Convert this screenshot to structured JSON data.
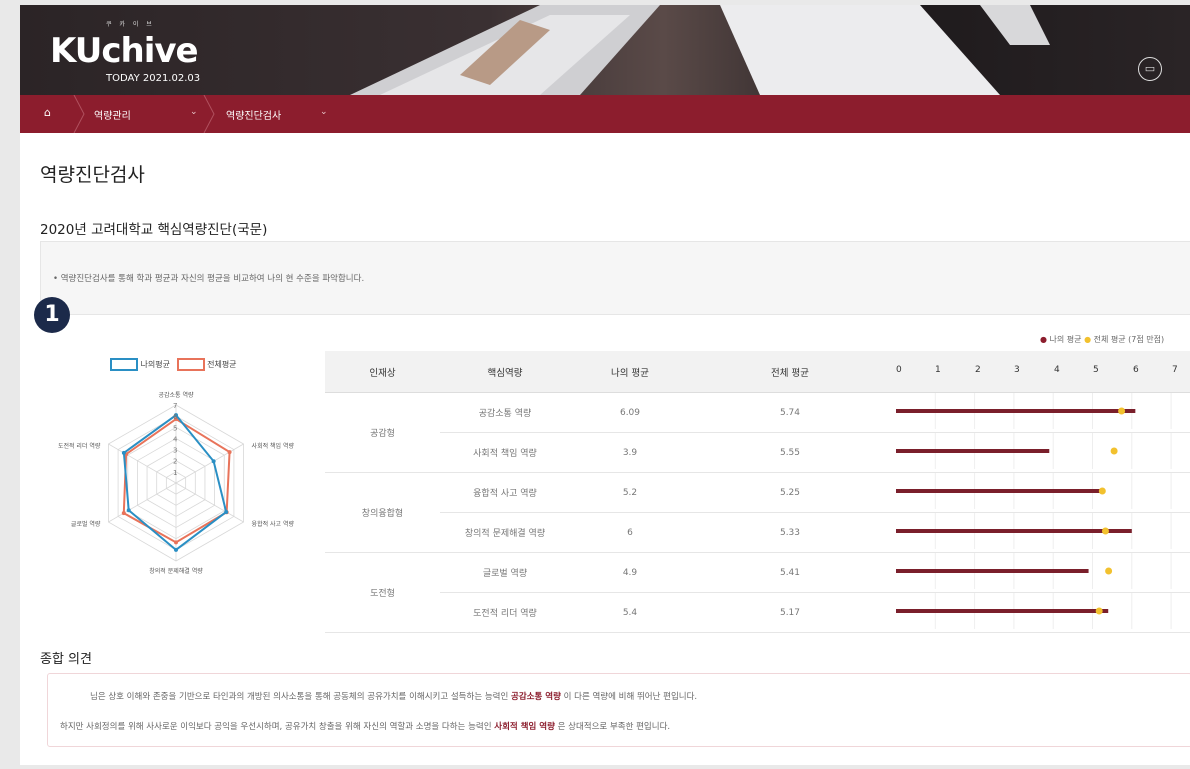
{
  "header": {
    "logo_small": "쿠 카 이 브",
    "logo_text": "KUchive",
    "today": "TODAY 2021.02.03",
    "icon": "book-icon"
  },
  "nav": {
    "home_icon": "home-icon",
    "items": [
      {
        "label": "역량관리"
      },
      {
        "label": "역량진단검사"
      }
    ]
  },
  "page_title": "역량진단검사",
  "subtitle": "2020년 고려대학교 핵심역량진단(국문)",
  "info": "• 역량진단검사를 통해 학과 평균과 자신의 평균을 비교하여 나의 현 수준을 파악합니다.",
  "badge": "1",
  "legend_top": {
    "mine": "나의 평균",
    "all": "전체 평균",
    "note": "(7점 만점)"
  },
  "colors": {
    "accent": "#8c1d2d",
    "mine_bar": "#7a1f2b",
    "all_dot": "#f2c12e",
    "radar_mine": "#2a8fc4",
    "radar_all": "#e8735a"
  },
  "radar": {
    "legend_mine": "나의평균",
    "legend_all": "전체평균",
    "axes": [
      "공감소통 역량",
      "사회적 책임 역량",
      "융합적 사고 역량",
      "창의적 문제해결 역량",
      "글로벌 역량",
      "도전적 리더 역량"
    ],
    "mine": [
      6.09,
      3.9,
      5.2,
      6,
      4.9,
      5.4
    ],
    "all": [
      5.74,
      5.55,
      5.25,
      5.33,
      5.41,
      5.17
    ],
    "ticks": [
      "1",
      "2",
      "3",
      "4",
      "5",
      "6",
      "7"
    ],
    "max": 7
  },
  "table": {
    "headers": [
      "인재상",
      "핵심역량",
      "나의 평균",
      "전체 평균"
    ],
    "scale": [
      "0",
      "1",
      "2",
      "3",
      "4",
      "5",
      "6",
      "7"
    ],
    "groups": [
      "공감형",
      "창의융합형",
      "도전형"
    ],
    "rows": [
      {
        "name": "공감소통 역량",
        "mine": "6.09",
        "all": "5.74"
      },
      {
        "name": "사회적 책임 역량",
        "mine": "3.9",
        "all": "5.55"
      },
      {
        "name": "융합적 사고 역량",
        "mine": "5.2",
        "all": "5.25"
      },
      {
        "name": "창의적 문제해결 역량",
        "mine": "6",
        "all": "5.33"
      },
      {
        "name": "글로벌 역량",
        "mine": "4.9",
        "all": "5.41"
      },
      {
        "name": "도전적 리더 역량",
        "mine": "5.4",
        "all": "5.17"
      }
    ]
  },
  "opinion": {
    "title": "종합 의견",
    "line1_pre": "님은 상호 이해와 존중을 기반으로 타인과의 개방된 의사소통을 통해 공동체의 공유가치를 이해시키고 설득하는 능력인 ",
    "line1_bold": "공감소통 역량",
    "line1_post": " 이 다른 역량에 비해 뛰어난 편입니다.",
    "line2_pre": "하지만 사회정의를 위해 사사로운 이익보다 공익을 우선시하며, 공유가치 창출을 위해 자신의 역할과 소명을 다하는 능력인 ",
    "line2_bold": "사회적 책임 역량",
    "line2_post": " 은 상대적으로 부족한 편입니다."
  }
}
